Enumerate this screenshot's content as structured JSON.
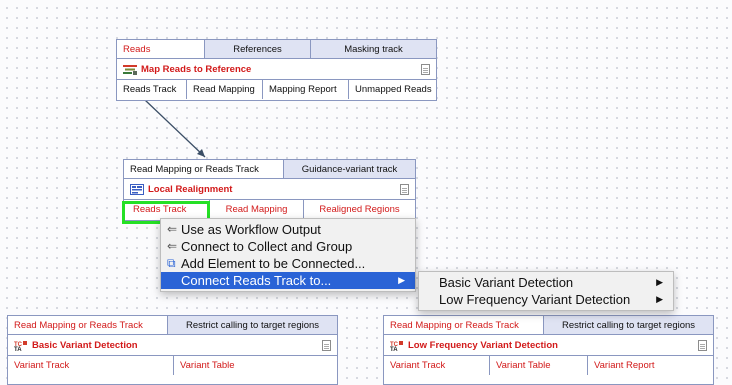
{
  "nodes": {
    "map": {
      "inputs": [
        "Reads",
        "References",
        "Masking track"
      ],
      "title": "Map Reads to Reference",
      "outputs": [
        "Reads Track",
        "Read Mapping",
        "Mapping Report",
        "Unmapped Reads"
      ]
    },
    "local": {
      "inputs": [
        "Read Mapping or Reads Track",
        "Guidance-variant track"
      ],
      "title": "Local Realignment",
      "outputs": [
        "Reads Track",
        "Read Mapping",
        "Realigned Regions"
      ]
    },
    "basic": {
      "inputs": [
        "Read Mapping or Reads Track",
        "Restrict calling to target regions"
      ],
      "title": "Basic Variant Detection",
      "outputs": [
        "Variant Track",
        "Variant Table"
      ]
    },
    "lowfreq": {
      "inputs": [
        "Read Mapping or Reads Track",
        "Restrict calling to target regions"
      ],
      "title": "Low Frequency Variant Detection",
      "outputs": [
        "Variant Track",
        "Variant Table",
        "Variant Report"
      ]
    }
  },
  "context_menu": {
    "items": [
      {
        "label": "Use as Workflow Output",
        "icon": "output-arrow-icon"
      },
      {
        "label": "Connect to Collect and Group",
        "icon": "collect-arrow-icon"
      },
      {
        "label": "Add Element to be Connected...",
        "icon": "add-element-icon"
      },
      {
        "label": "Connect Reads Track to...",
        "icon": "",
        "selected": true,
        "submenu": true
      }
    ]
  },
  "submenu": {
    "items": [
      {
        "label": "Basic Variant Detection"
      },
      {
        "label": "Low Frequency Variant Detection"
      }
    ]
  },
  "colors": {
    "red_label": "#d21a1a",
    "highlight_green": "#25e025",
    "menu_selection": "#2a63d6",
    "node_border": "#8a97c0",
    "port_header": "#dfe3f3"
  }
}
